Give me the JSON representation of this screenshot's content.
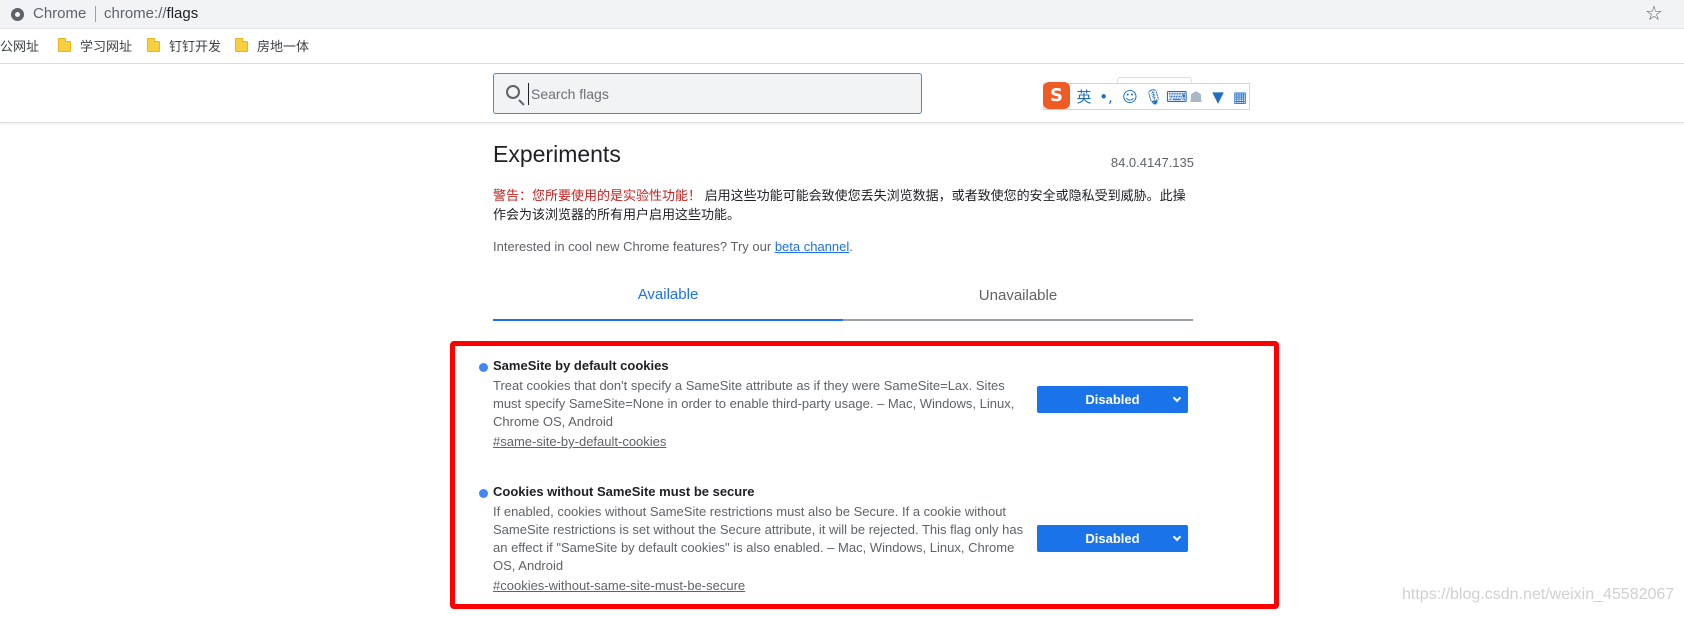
{
  "omnibox": {
    "site_name": "Chrome",
    "url_scheme": "chrome://",
    "url_host": "flags"
  },
  "bookmarks": [
    {
      "label": "办公网址"
    },
    {
      "label": "学习网址"
    },
    {
      "label": "钉钉开发"
    },
    {
      "label": "房地一体"
    }
  ],
  "search": {
    "placeholder": "Search flags"
  },
  "ime": {
    "logo": "S",
    "lang": "英",
    "punct": "•,",
    "icons": [
      "emoji-icon",
      "microphone-icon",
      "keyboard-icon",
      "user-icon",
      "shirt-icon",
      "grid-icon"
    ]
  },
  "header": {
    "title": "Experiments",
    "version": "84.0.4147.135",
    "warning_red": "警告：您所要使用的是实验性功能！",
    "warning_rest": " 启用这些功能可能会致使您丢失浏览数据，或者致使您的安全或隐私受到威胁。此操作会为该浏览器的所有用户启用这些功能。",
    "promo_prefix": "Interested in cool new Chrome features? Try our ",
    "promo_link": "beta channel",
    "promo_suffix": "."
  },
  "tabs": [
    {
      "label": "Available"
    },
    {
      "label": "Unavailable"
    }
  ],
  "flags": [
    {
      "name": "SameSite by default cookies",
      "description": "Treat cookies that don't specify a SameSite attribute as if they were SameSite=Lax. Sites must specify SameSite=None in order to enable third-party usage. – Mac, Windows, Linux, Chrome OS, Android",
      "anchor": "#same-site-by-default-cookies",
      "value": "Disabled"
    },
    {
      "name": "Cookies without SameSite must be secure",
      "description": "If enabled, cookies without SameSite restrictions must also be Secure. If a cookie without SameSite restrictions is set without the Secure attribute, it will be rejected. This flag only has an effect if \"SameSite by default cookies\" is also enabled. – Mac, Windows, Linux, Chrome OS, Android",
      "anchor": "#cookies-without-same-site-must-be-secure",
      "value": "Disabled"
    }
  ],
  "watermark": "https://blog.csdn.net/weixin_45582067",
  "colors": {
    "accent": "#1a73e8",
    "warning": "#c5221f",
    "highlight_frame": "#ff0000"
  }
}
